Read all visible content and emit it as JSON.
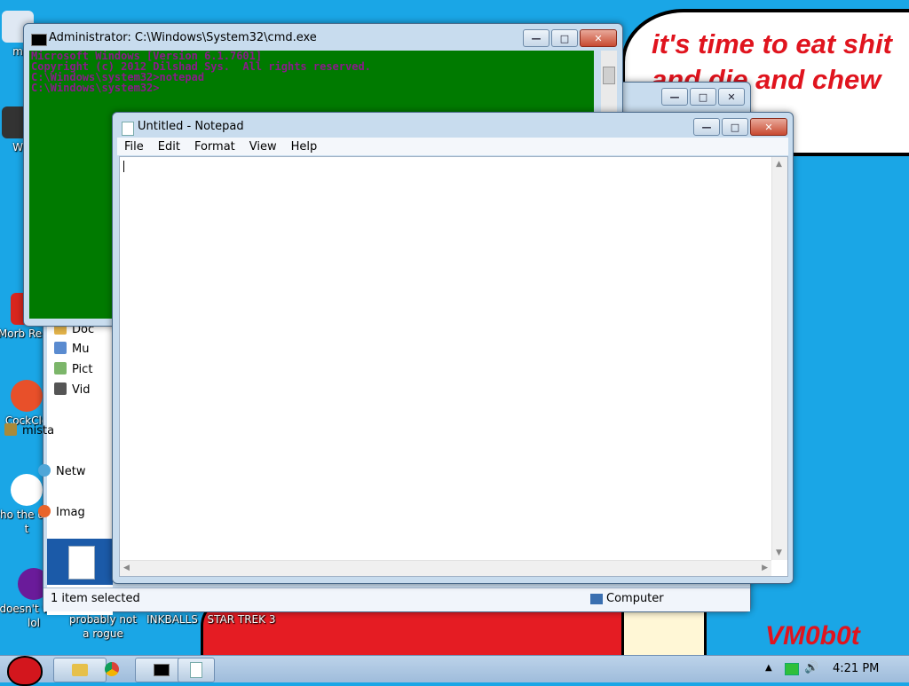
{
  "desktop": {
    "bubble_text": "it's time to eat shit and die and chew gum",
    "signature": "VM0b0t",
    "icons": [
      {
        "label": "m",
        "icon": "app-icon"
      },
      {
        "label": "W",
        "icon": "app-icon"
      },
      {
        "label": "Morb Read",
        "icon": "app-icon"
      },
      {
        "label": "CockCle",
        "icon": "ccleaner-icon"
      },
      {
        "label": "who the uses t",
        "icon": "app-icon"
      },
      {
        "label": "doesn't work lol",
        "icon": "yahoo-icon"
      },
      {
        "label": "probably not a rogue",
        "icon": "app-icon"
      },
      {
        "label": "INKBALLS",
        "icon": "app-icon"
      },
      {
        "label": "STAR TREK 3",
        "icon": "app-icon"
      }
    ]
  },
  "cmd": {
    "title": "Administrator: C:\\Windows\\System32\\cmd.exe",
    "console_bg": "#007a00",
    "console_fg": "#8a1a8a",
    "lines": [
      "Microsoft Windows [Version 6.1.7601]",
      "Copyright (c) 2012 Dilshad Sys.  All rights reserved.",
      "",
      "C:\\Windows\\system32>notepad",
      "",
      "C:\\Windows\\system32>"
    ]
  },
  "explorer": {
    "nav_items": [
      "Doc",
      "Mu",
      "Pict",
      "Vid",
      "mista",
      "Netw",
      "Imag"
    ],
    "status_selected": "1 item selected",
    "status_location": "Computer"
  },
  "notepad": {
    "title": "Untitled - Notepad",
    "menu": [
      "File",
      "Edit",
      "Format",
      "View",
      "Help"
    ],
    "content": ""
  },
  "window_controls": {
    "minimize": "—",
    "maximize": "□",
    "close": "✕"
  },
  "taskbar": {
    "time": "4:21 PM",
    "buttons": [
      "explorer-icon",
      "chrome-icon",
      "cmd-icon",
      "notepad-icon"
    ]
  }
}
